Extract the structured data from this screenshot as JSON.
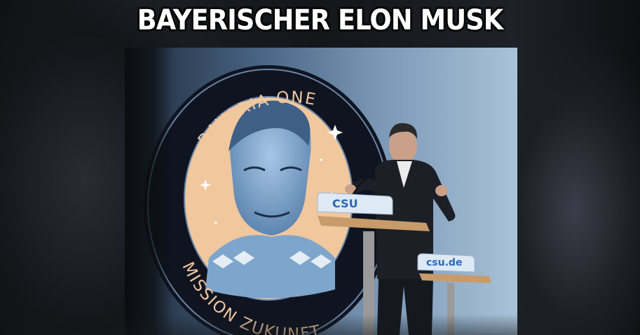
{
  "headline": "BAYERISCHER ELON MUSK",
  "emblem": {
    "top_text": "BAVARIA ONE",
    "bottom_text": "MISSION ZUKUNFT"
  },
  "lectern_front": {
    "label": "CSU"
  },
  "lectern_back": {
    "label": "csu.de"
  },
  "colors": {
    "emblem_ring": "#0f1420",
    "emblem_inner": "#f1c79e",
    "emblem_face": "#8ab0d8",
    "lectern_blue": "#2a68b8",
    "wood": "#c79b6a"
  }
}
